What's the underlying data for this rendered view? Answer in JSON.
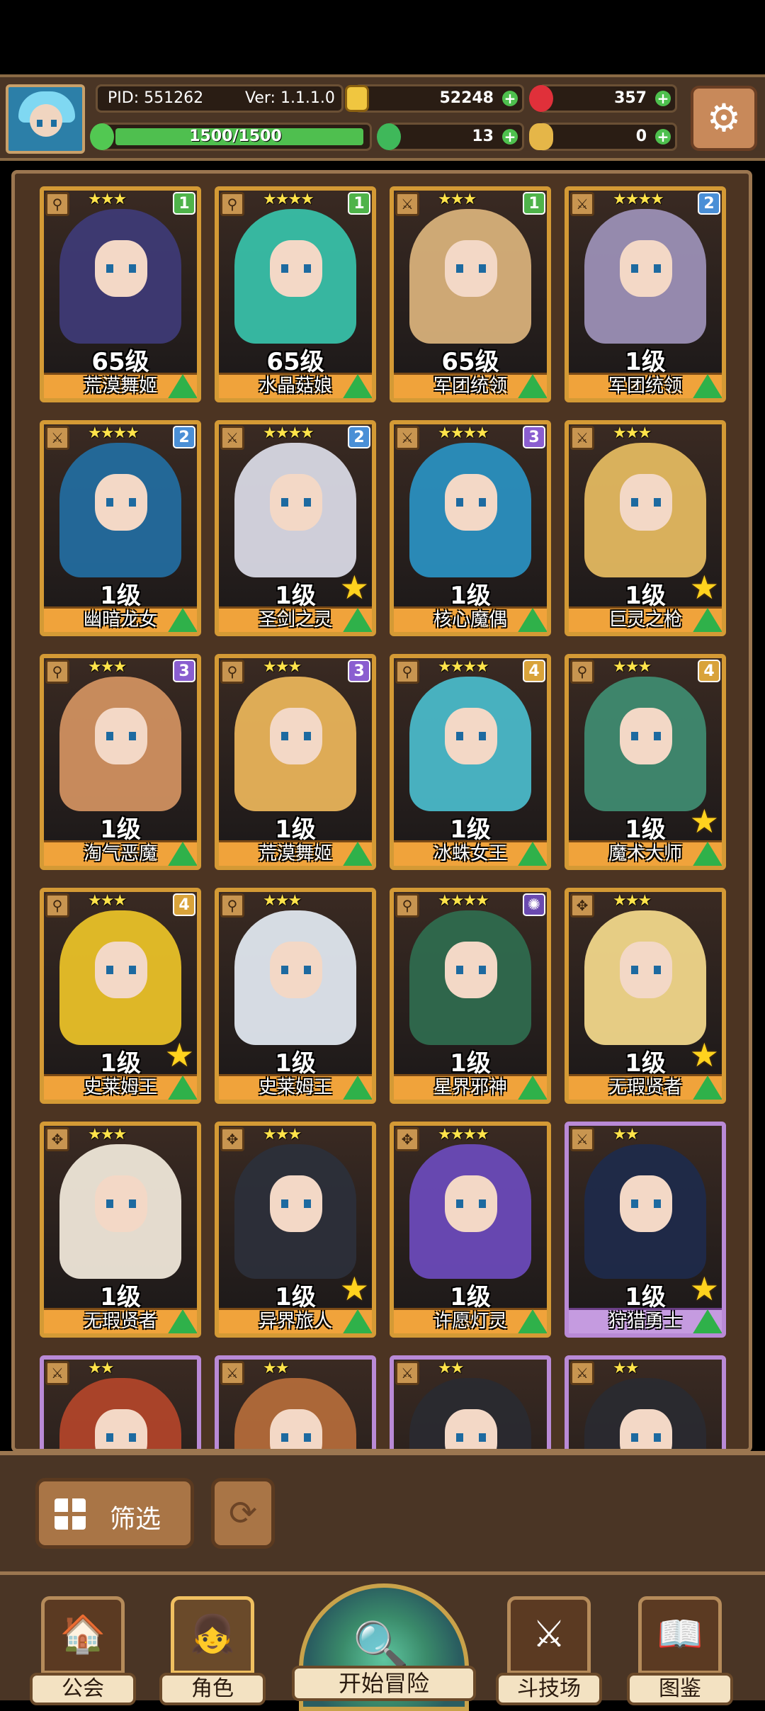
{
  "header": {
    "pid_label": "PID: 551262",
    "version_label": "Ver: 1.1.1.0",
    "gold": "52248",
    "gems": "357",
    "energy": "1500/1500",
    "clover": "13",
    "key": "0"
  },
  "colors": {
    "gold_frame": "#d49a35",
    "purple_frame": "#b98ad6",
    "name_gold": "#f0a33b",
    "name_purple": "#c59be0",
    "plus_green": "#4ec04e",
    "up_arrow_green": "#2fb14a"
  },
  "characters": [
    {
      "name": "荒漠舞姬",
      "level": "65级",
      "stars": "★★★",
      "badge": "1",
      "badge_color": "#4fb34a",
      "rarity": "gold",
      "weapon_icon": "staff-icon",
      "hair": "#3e3a75",
      "has_star": false
    },
    {
      "name": "水晶菇娘",
      "level": "65级",
      "stars": "★★★★",
      "badge": "1",
      "badge_color": "#4fb34a",
      "rarity": "gold",
      "weapon_icon": "staff-icon",
      "hair": "#38bfa8",
      "has_star": false
    },
    {
      "name": "军团统领",
      "level": "65级",
      "stars": "★★★",
      "badge": "1",
      "badge_color": "#4fb34a",
      "rarity": "gold",
      "weapon_icon": "sword-icon",
      "hair": "#d7b07a",
      "has_star": false
    },
    {
      "name": "军团统领",
      "level": "1级",
      "stars": "★★★★",
      "badge": "2",
      "badge_color": "#4a8fd6",
      "rarity": "gold",
      "weapon_icon": "sword-icon",
      "hair": "#9b8fb5",
      "has_star": false
    },
    {
      "name": "幽暗龙女",
      "level": "1级",
      "stars": "★★★★",
      "badge": "2",
      "badge_color": "#4a8fd6",
      "rarity": "gold",
      "weapon_icon": "sword-icon",
      "hair": "#236b9e",
      "has_star": false
    },
    {
      "name": "圣剑之灵",
      "level": "1级",
      "stars": "★★★★",
      "badge": "2",
      "badge_color": "#4a8fd6",
      "rarity": "gold",
      "weapon_icon": "sword-icon",
      "hair": "#d8d8e4",
      "has_star": true
    },
    {
      "name": "核心魔偶",
      "level": "1级",
      "stars": "★★★★",
      "badge": "3",
      "badge_color": "#8a5ed0",
      "rarity": "gold",
      "weapon_icon": "sword-icon",
      "hair": "#2a8fbf",
      "has_star": false
    },
    {
      "name": "巨灵之枪",
      "level": "1级",
      "stars": "★★★",
      "badge": "",
      "badge_color": "",
      "rarity": "gold",
      "weapon_icon": "sword-icon",
      "hair": "#e3b860",
      "has_star": true
    },
    {
      "name": "淘气恶魔",
      "level": "1级",
      "stars": "★★★",
      "badge": "3",
      "badge_color": "#8a5ed0",
      "rarity": "gold",
      "weapon_icon": "staff-icon",
      "hair": "#d09060",
      "has_star": false
    },
    {
      "name": "荒漠舞姬",
      "level": "1级",
      "stars": "★★★",
      "badge": "3",
      "badge_color": "#8a5ed0",
      "rarity": "gold",
      "weapon_icon": "staff-icon",
      "hair": "#e8b35a",
      "has_star": false
    },
    {
      "name": "冰蛛女王",
      "level": "1级",
      "stars": "★★★★",
      "badge": "4",
      "badge_color": "#d9a33a",
      "rarity": "gold",
      "weapon_icon": "staff-icon",
      "hair": "#4ab8c8",
      "has_star": false
    },
    {
      "name": "魔术大师",
      "level": "1级",
      "stars": "★★★",
      "badge": "4",
      "badge_color": "#d9a33a",
      "rarity": "gold",
      "weapon_icon": "staff-icon",
      "hair": "#3f8a70",
      "has_star": true
    },
    {
      "name": "史莱姆王",
      "level": "1级",
      "stars": "★★★",
      "badge": "4",
      "badge_color": "#d9a33a",
      "rarity": "gold",
      "weapon_icon": "staff-icon",
      "hair": "#e8c028",
      "has_star": true
    },
    {
      "name": "史莱姆王",
      "level": "1级",
      "stars": "★★★",
      "badge": "",
      "badge_color": "",
      "rarity": "gold",
      "weapon_icon": "staff-icon",
      "hair": "#dfe6ee",
      "has_star": false
    },
    {
      "name": "星界邪神",
      "level": "1级",
      "stars": "★★★★",
      "badge": "✺",
      "badge_color": "#6a4ab0",
      "rarity": "gold",
      "weapon_icon": "staff-icon",
      "hair": "#2f6a4e",
      "has_star": false
    },
    {
      "name": "无瑕贤者",
      "level": "1级",
      "stars": "★★★",
      "badge": "",
      "badge_color": "",
      "rarity": "gold",
      "weapon_icon": "orb-icon",
      "hair": "#f0d68a",
      "has_star": true
    },
    {
      "name": "无瑕贤者",
      "level": "1级",
      "stars": "★★★",
      "badge": "",
      "badge_color": "",
      "rarity": "gold",
      "weapon_icon": "orb-icon",
      "hair": "#eee6d8",
      "has_star": false
    },
    {
      "name": "异界旅人",
      "level": "1级",
      "stars": "★★★",
      "badge": "",
      "badge_color": "",
      "rarity": "gold",
      "weapon_icon": "orb-icon",
      "hair": "#2c2f3a",
      "has_star": true
    },
    {
      "name": "许愿灯灵",
      "level": "1级",
      "stars": "★★★★",
      "badge": "",
      "badge_color": "",
      "rarity": "gold",
      "weapon_icon": "orb-icon",
      "hair": "#6a4ab8",
      "has_star": false
    },
    {
      "name": "狩猎勇士",
      "level": "1级",
      "stars": "★★",
      "badge": "",
      "badge_color": "",
      "rarity": "purple",
      "weapon_icon": "sword-icon",
      "hair": "#1f2a4a",
      "has_star": true
    },
    {
      "name": "",
      "level": "",
      "stars": "★★",
      "badge": "",
      "badge_color": "",
      "rarity": "purple",
      "weapon_icon": "sword-icon",
      "hair": "#b0442a",
      "has_star": false
    },
    {
      "name": "",
      "level": "",
      "stars": "★★",
      "badge": "",
      "badge_color": "",
      "rarity": "purple",
      "weapon_icon": "sword-icon",
      "hair": "#b26a3a",
      "has_star": false
    },
    {
      "name": "",
      "level": "",
      "stars": "★★",
      "badge": "",
      "badge_color": "",
      "rarity": "purple",
      "weapon_icon": "sword-icon",
      "hair": "#2a2a30",
      "has_star": false
    },
    {
      "name": "",
      "level": "",
      "stars": "★★",
      "badge": "",
      "badge_color": "",
      "rarity": "purple",
      "weapon_icon": "sword-icon",
      "hair": "#2a2a30",
      "has_star": false
    }
  ],
  "controls": {
    "filter_label": "筛选"
  },
  "nav": {
    "guild": "公会",
    "character": "角色",
    "adventure": "开始冒险",
    "arena": "斗技场",
    "codex": "图鉴"
  }
}
